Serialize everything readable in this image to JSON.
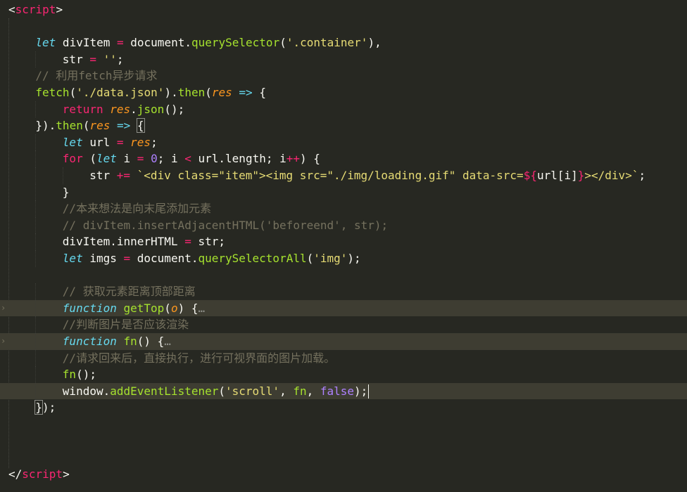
{
  "colors": {
    "background": "#272822",
    "plain": "#f8f8f2",
    "keyword": "#f92672",
    "storage": "#66d9ef",
    "string": "#e6db74",
    "function": "#a6e22e",
    "comment": "#75715e",
    "number": "#ae81ff",
    "parameter": "#fd971f",
    "line_highlight": "#3e3d32"
  },
  "icons": {
    "fold": "fold-arrow-icon",
    "ellipsis": "folded-ellipsis-icon"
  },
  "lines": [
    {
      "indent": 0,
      "tokens": [
        {
          "t": "<",
          "c": "plain"
        },
        {
          "t": "script",
          "c": "keyword"
        },
        {
          "t": ">",
          "c": "plain"
        }
      ]
    },
    {
      "indent": 0,
      "tokens": []
    },
    {
      "indent": 1,
      "tokens": [
        {
          "t": "let",
          "c": "storage",
          "i": true
        },
        {
          "t": " divItem ",
          "c": "plain"
        },
        {
          "t": "=",
          "c": "keyword"
        },
        {
          "t": " document.",
          "c": "plain"
        },
        {
          "t": "querySelector",
          "c": "function"
        },
        {
          "t": "(",
          "c": "plain"
        },
        {
          "t": "'.container'",
          "c": "string"
        },
        {
          "t": "),",
          "c": "plain"
        }
      ]
    },
    {
      "indent": 2,
      "tokens": [
        {
          "t": "str ",
          "c": "plain"
        },
        {
          "t": "=",
          "c": "keyword"
        },
        {
          "t": " ",
          "c": "plain"
        },
        {
          "t": "''",
          "c": "string"
        },
        {
          "t": ";",
          "c": "plain"
        }
      ]
    },
    {
      "indent": 1,
      "tokens": [
        {
          "t": "// 利用fetch异步请求",
          "c": "comment"
        }
      ]
    },
    {
      "indent": 1,
      "tokens": [
        {
          "t": "fetch",
          "c": "function"
        },
        {
          "t": "(",
          "c": "plain"
        },
        {
          "t": "'./data.json'",
          "c": "string"
        },
        {
          "t": ").",
          "c": "plain"
        },
        {
          "t": "then",
          "c": "function"
        },
        {
          "t": "(",
          "c": "plain"
        },
        {
          "t": "res",
          "c": "parameter",
          "i": true
        },
        {
          "t": " ",
          "c": "plain"
        },
        {
          "t": "=>",
          "c": "storage"
        },
        {
          "t": " {",
          "c": "plain"
        }
      ]
    },
    {
      "indent": 2,
      "tokens": [
        {
          "t": "return",
          "c": "keyword"
        },
        {
          "t": " ",
          "c": "plain"
        },
        {
          "t": "res",
          "c": "parameter",
          "i": true
        },
        {
          "t": ".",
          "c": "plain"
        },
        {
          "t": "json",
          "c": "function"
        },
        {
          "t": "();",
          "c": "plain"
        }
      ]
    },
    {
      "indent": 1,
      "tokens": [
        {
          "t": "}).",
          "c": "plain"
        },
        {
          "t": "then",
          "c": "function"
        },
        {
          "t": "(",
          "c": "plain"
        },
        {
          "t": "res",
          "c": "parameter",
          "i": true
        },
        {
          "t": " ",
          "c": "plain"
        },
        {
          "t": "=>",
          "c": "storage"
        },
        {
          "t": " ",
          "c": "plain"
        },
        {
          "t": "{",
          "c": "plain",
          "box": true
        }
      ]
    },
    {
      "indent": 2,
      "tokens": [
        {
          "t": "let",
          "c": "storage",
          "i": true
        },
        {
          "t": " url ",
          "c": "plain"
        },
        {
          "t": "=",
          "c": "keyword"
        },
        {
          "t": " ",
          "c": "plain"
        },
        {
          "t": "res",
          "c": "parameter",
          "i": true
        },
        {
          "t": ";",
          "c": "plain"
        }
      ]
    },
    {
      "indent": 2,
      "tokens": [
        {
          "t": "for",
          "c": "keyword"
        },
        {
          "t": " (",
          "c": "plain"
        },
        {
          "t": "let",
          "c": "storage",
          "i": true
        },
        {
          "t": " i ",
          "c": "plain"
        },
        {
          "t": "=",
          "c": "keyword"
        },
        {
          "t": " ",
          "c": "plain"
        },
        {
          "t": "0",
          "c": "number"
        },
        {
          "t": "; i ",
          "c": "plain"
        },
        {
          "t": "<",
          "c": "keyword"
        },
        {
          "t": " url.length; i",
          "c": "plain"
        },
        {
          "t": "++",
          "c": "keyword"
        },
        {
          "t": ") {",
          "c": "plain"
        }
      ]
    },
    {
      "indent": 3,
      "tokens": [
        {
          "t": "str ",
          "c": "plain"
        },
        {
          "t": "+=",
          "c": "keyword"
        },
        {
          "t": " `",
          "c": "string"
        },
        {
          "t": "<div class=\"item\"><img src=\"./img/loading.gif\" data-src=",
          "c": "string"
        },
        {
          "t": "${",
          "c": "keyword"
        },
        {
          "t": "url[i]",
          "c": "plain"
        },
        {
          "t": "}",
          "c": "keyword"
        },
        {
          "t": "></div>`",
          "c": "string"
        },
        {
          "t": ";",
          "c": "plain"
        }
      ]
    },
    {
      "indent": 2,
      "tokens": [
        {
          "t": "}",
          "c": "plain"
        }
      ]
    },
    {
      "indent": 2,
      "tokens": [
        {
          "t": "//本来想法是向末尾添加元素",
          "c": "comment"
        }
      ]
    },
    {
      "indent": 2,
      "tokens": [
        {
          "t": "// divItem.insertAdjacentHTML('beforeend', str);",
          "c": "comment"
        }
      ]
    },
    {
      "indent": 2,
      "tokens": [
        {
          "t": "divItem.innerHTML ",
          "c": "plain"
        },
        {
          "t": "=",
          "c": "keyword"
        },
        {
          "t": " str;",
          "c": "plain"
        }
      ]
    },
    {
      "indent": 2,
      "tokens": [
        {
          "t": "let",
          "c": "storage",
          "i": true
        },
        {
          "t": " imgs ",
          "c": "plain"
        },
        {
          "t": "=",
          "c": "keyword"
        },
        {
          "t": " document.",
          "c": "plain"
        },
        {
          "t": "querySelectorAll",
          "c": "function"
        },
        {
          "t": "(",
          "c": "plain"
        },
        {
          "t": "'img'",
          "c": "string"
        },
        {
          "t": ");",
          "c": "plain"
        }
      ]
    },
    {
      "indent": 0,
      "tokens": []
    },
    {
      "indent": 2,
      "tokens": [
        {
          "t": "// 获取元素距离顶部距离",
          "c": "comment"
        }
      ]
    },
    {
      "indent": 2,
      "hl": true,
      "fold": true,
      "tokens": [
        {
          "t": "function",
          "c": "storage",
          "i": true
        },
        {
          "t": " ",
          "c": "plain"
        },
        {
          "t": "getTop",
          "c": "function"
        },
        {
          "t": "(",
          "c": "plain"
        },
        {
          "t": "o",
          "c": "parameter",
          "i": true
        },
        {
          "t": ") {",
          "c": "plain"
        },
        {
          "t": "…",
          "c": "ellipsis"
        }
      ]
    },
    {
      "indent": 2,
      "tokens": [
        {
          "t": "//判断图片是否应该渲染",
          "c": "comment"
        }
      ]
    },
    {
      "indent": 2,
      "hl": true,
      "fold": true,
      "tokens": [
        {
          "t": "function",
          "c": "storage",
          "i": true
        },
        {
          "t": " ",
          "c": "plain"
        },
        {
          "t": "fn",
          "c": "function"
        },
        {
          "t": "() {",
          "c": "plain"
        },
        {
          "t": "…",
          "c": "ellipsis"
        }
      ]
    },
    {
      "indent": 2,
      "tokens": [
        {
          "t": "//请求回来后，直接执行，进行可视界面的图片加载。",
          "c": "comment"
        }
      ]
    },
    {
      "indent": 2,
      "tokens": [
        {
          "t": "fn",
          "c": "function"
        },
        {
          "t": "();",
          "c": "plain"
        }
      ]
    },
    {
      "indent": 2,
      "hl": true,
      "cursor": true,
      "tokens": [
        {
          "t": "window.",
          "c": "plain"
        },
        {
          "t": "addEventListener",
          "c": "function"
        },
        {
          "t": "(",
          "c": "plain"
        },
        {
          "t": "'scroll'",
          "c": "string"
        },
        {
          "t": ", ",
          "c": "plain"
        },
        {
          "t": "fn",
          "c": "function"
        },
        {
          "t": ", ",
          "c": "plain"
        },
        {
          "t": "false",
          "c": "number"
        },
        {
          "t": ");",
          "c": "plain"
        }
      ]
    },
    {
      "indent": 1,
      "tokens": [
        {
          "t": "}",
          "c": "plain",
          "box": true
        },
        {
          "t": ");",
          "c": "plain"
        }
      ]
    },
    {
      "indent": 0,
      "tokens": []
    },
    {
      "indent": 0,
      "tokens": []
    },
    {
      "indent": 0,
      "tokens": []
    },
    {
      "indent": 0,
      "tokens": [
        {
          "t": "</",
          "c": "plain"
        },
        {
          "t": "script",
          "c": "keyword"
        },
        {
          "t": ">",
          "c": "plain"
        }
      ]
    }
  ]
}
